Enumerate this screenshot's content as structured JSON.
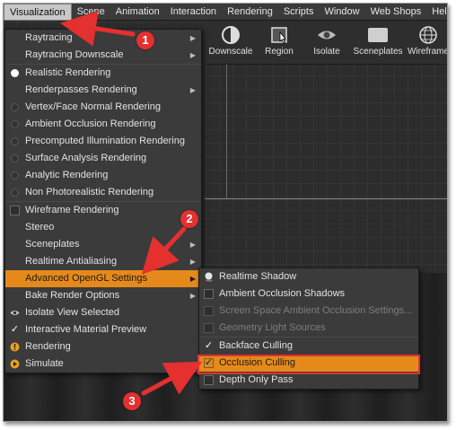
{
  "menubar": {
    "items": [
      "Visualization",
      "Scene",
      "Animation",
      "Interaction",
      "Rendering",
      "Scripts",
      "Window",
      "Web Shops",
      "Help"
    ]
  },
  "toolbar": {
    "items": [
      {
        "label": "Downscale",
        "icon": "half-circle-icon"
      },
      {
        "label": "Region",
        "icon": "region-square-icon"
      },
      {
        "label": "Isolate",
        "icon": "eye-icon"
      },
      {
        "label": "Sceneplates",
        "icon": "sceneplate-icon"
      },
      {
        "label": "Wireframe",
        "icon": "wireframe-sphere-icon"
      }
    ]
  },
  "visualization_menu": {
    "items": [
      {
        "label": "Raytracing",
        "submenu": true,
        "left": "none"
      },
      {
        "label": "Raytracing Downscale",
        "submenu": true,
        "left": "none"
      },
      {
        "label": "Realistic Rendering",
        "left": "radio-on"
      },
      {
        "label": "Renderpasses Rendering",
        "submenu": true,
        "left": "none"
      },
      {
        "label": "Vertex/Face Normal Rendering",
        "left": "radio-off"
      },
      {
        "label": "Ambient Occlusion Rendering",
        "left": "radio-off"
      },
      {
        "label": "Precomputed Illumination Rendering",
        "left": "radio-off"
      },
      {
        "label": "Surface Analysis Rendering",
        "left": "radio-off"
      },
      {
        "label": "Analytic Rendering",
        "left": "radio-off"
      },
      {
        "label": "Non Photorealistic Rendering",
        "left": "radio-off"
      },
      {
        "label": "Wireframe Rendering",
        "left": "checkbox"
      },
      {
        "label": "Stereo",
        "left": "none"
      },
      {
        "label": "Sceneplates",
        "submenu": true,
        "left": "none"
      },
      {
        "label": "Realtime Antialiasing",
        "submenu": true,
        "left": "none"
      },
      {
        "label": "Advanced OpenGL Settings",
        "submenu": true,
        "highlighted": true,
        "left": "none"
      },
      {
        "label": "Bake Render Options",
        "submenu": true,
        "left": "none"
      },
      {
        "label": "Isolate View Selected",
        "left": "eye-icon"
      },
      {
        "label": "Interactive Material Preview",
        "left": "check"
      },
      {
        "label": "Rendering",
        "left": "exclamation-icon"
      },
      {
        "label": "Simulate",
        "left": "play-icon"
      }
    ]
  },
  "opengl_submenu": {
    "items": [
      {
        "label": "Realtime Shadow",
        "left": "shadow-icon"
      },
      {
        "label": "Ambient Occlusion Shadows",
        "left": "checkbox"
      },
      {
        "label": "Screen Space Ambient Occlusion Settings...",
        "left": "checkbox",
        "disabled": true
      },
      {
        "label": "Geometry Light Sources",
        "left": "checkbox",
        "disabled": true
      },
      {
        "label": "Backface Culling",
        "left": "check"
      },
      {
        "label": "Occlusion Culling",
        "left": "check",
        "highlighted": true
      },
      {
        "label": "Depth Only Pass",
        "left": "checkbox"
      }
    ]
  },
  "annotations": {
    "markers": [
      "1",
      "2",
      "3"
    ],
    "color": "#e53030"
  },
  "colors": {
    "highlight": "#e58a1a",
    "menu_bg": "#3b3b3b",
    "annotation": "#e53030"
  }
}
